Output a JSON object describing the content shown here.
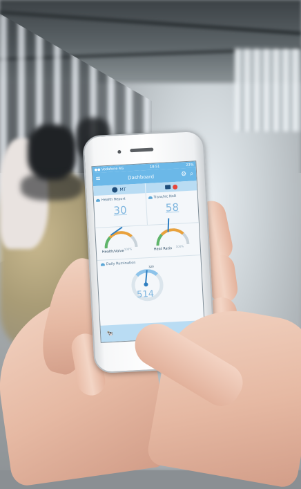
{
  "status_bar": {
    "carrier": "●● Vodafone 4G",
    "time": "18:51",
    "battery": "23%"
  },
  "app_bar": {
    "title": "Dashboard",
    "menu_icon": "hamburger-icon",
    "settings_icon": "gear-icon",
    "search_icon": "search-icon"
  },
  "sub_bar": {
    "left_brand": "MT",
    "left_icon": "brand-logo-icon",
    "right_icon": "camera-icon",
    "alert_icon": "alert-dot-icon"
  },
  "cards": [
    {
      "label": "Health Report",
      "value": "30",
      "icon": "cow-icon"
    },
    {
      "label": "Trans/Vc NoR",
      "value": "58",
      "icon": "cow-icon"
    }
  ],
  "gauges": [
    {
      "caption": "Health/Valve",
      "max": "100%",
      "level": 0.72
    },
    {
      "caption": "Heat Ratio",
      "max": "100%",
      "level": 0.55
    }
  ],
  "rumination": {
    "label": "Daily Rumination",
    "max": "320",
    "value": "514",
    "icon": "cow-icon"
  },
  "tab_bar": {
    "left_icon": "herd-icon",
    "right_icon": "grid-icon"
  },
  "colors": {
    "app_blue": "#6bb8e8",
    "light_blue": "#b9dcf3",
    "value_blue": "#7fb6df"
  }
}
